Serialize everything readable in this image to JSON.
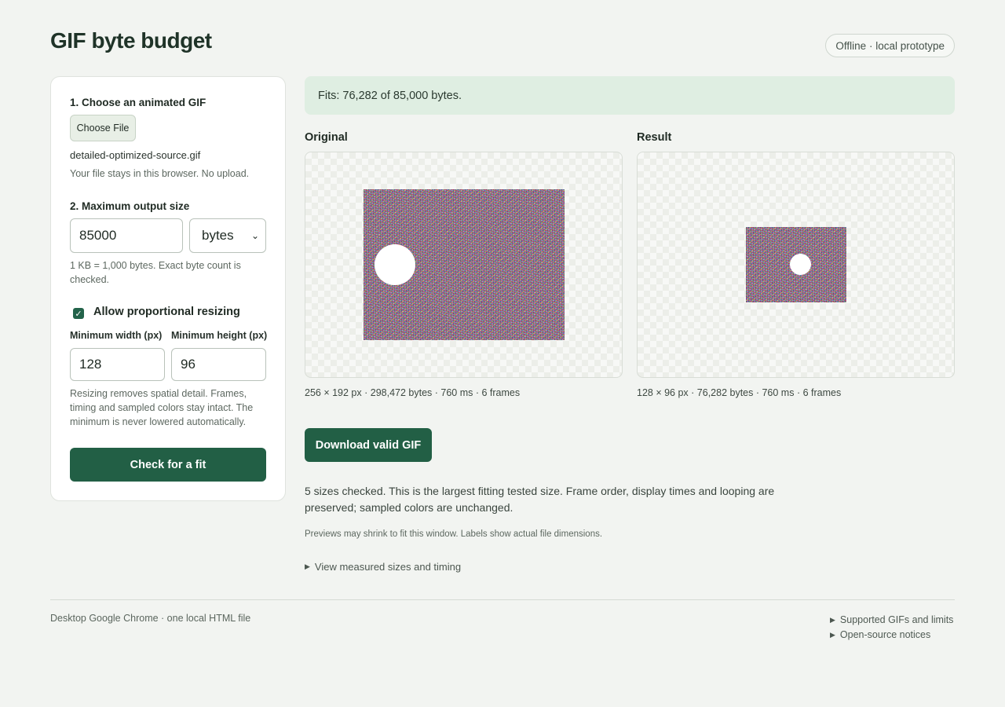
{
  "header": {
    "title": "GIF byte budget",
    "badge": "Offline · local prototype"
  },
  "sidebar": {
    "step1_label": "1. Choose an animated GIF",
    "choose_file_label": "Choose File",
    "file_name": "detailed-optimized-source.gif",
    "privacy_hint": "Your file stays in this browser. No upload.",
    "step2_label": "2. Maximum output size",
    "max_size_value": "85000",
    "unit_selected": "bytes",
    "unit_hint": "1 KB = 1,000 bytes. Exact byte count is checked.",
    "allow_resize_checked": true,
    "allow_resize_label": "Allow proportional resizing",
    "min_width_label": "Minimum width (px)",
    "min_width_value": "128",
    "min_height_label": "Minimum height (px)",
    "min_height_value": "96",
    "resize_hint": "Resizing removes spatial detail. Frames, timing and sampled colors stay intact. The minimum is never lowered automatically.",
    "check_button_label": "Check for a fit"
  },
  "main": {
    "status": "Fits: 76,282 of 85,000 bytes.",
    "original_heading": "Original",
    "original_caption": "256 × 192 px · 298,472 bytes · 760 ms · 6 frames",
    "result_heading": "Result",
    "result_caption": "128 × 96 px · 76,282 bytes · 760 ms · 6 frames",
    "download_label": "Download valid GIF",
    "summary": "5 sizes checked. This is the largest fitting tested size. Frame order, display times and looping are preserved; sampled colors are unchanged.",
    "preview_note": "Previews may shrink to fit this window. Labels show actual file dimensions.",
    "details_toggle": "View measured sizes and timing"
  },
  "footer": {
    "environment": "Desktop Google Chrome · one local HTML file",
    "link_limits": "Supported GIFs and limits",
    "link_notices": "Open-source notices"
  },
  "colors": {
    "accent": "#225f45",
    "success_banner": "#dfeee2",
    "background": "#f2f4f1"
  }
}
